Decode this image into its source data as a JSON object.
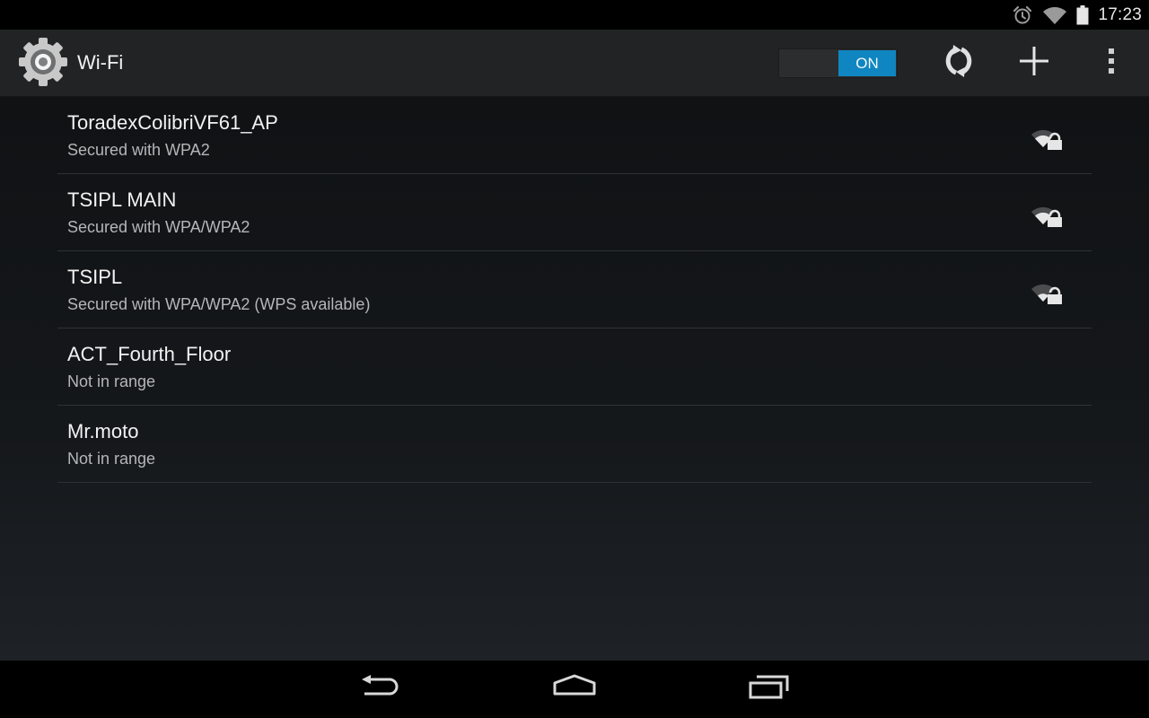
{
  "status_bar": {
    "time": "17:23",
    "icons": [
      "alarm-icon",
      "wifi-signal-icon",
      "battery-icon"
    ]
  },
  "action_bar": {
    "title": "Wi-Fi",
    "app_icon": "settings-gear-icon",
    "toggle_label": "ON",
    "toggle_on": true,
    "buttons": [
      "wps-push-icon",
      "add-network-icon",
      "overflow-menu-icon"
    ]
  },
  "networks": [
    {
      "name": "ToradexColibriVF61_AP",
      "status": "Secured with WPA2",
      "signal": "locked"
    },
    {
      "name": "TSIPL MAIN",
      "status": "Secured with WPA/WPA2",
      "signal": "locked"
    },
    {
      "name": "TSIPL",
      "status": "Secured with WPA/WPA2 (WPS available)",
      "signal": "locked"
    },
    {
      "name": "ACT_Fourth_Floor",
      "status": "Not in range",
      "signal": "none"
    },
    {
      "name": "Mr.moto",
      "status": "Not in range",
      "signal": "none"
    }
  ],
  "nav_bar": {
    "buttons": [
      "back-icon",
      "home-icon",
      "recents-icon"
    ]
  },
  "colors": {
    "accent": "#0f86c1",
    "action_bar": "#222324",
    "divider": "#2f3235"
  }
}
